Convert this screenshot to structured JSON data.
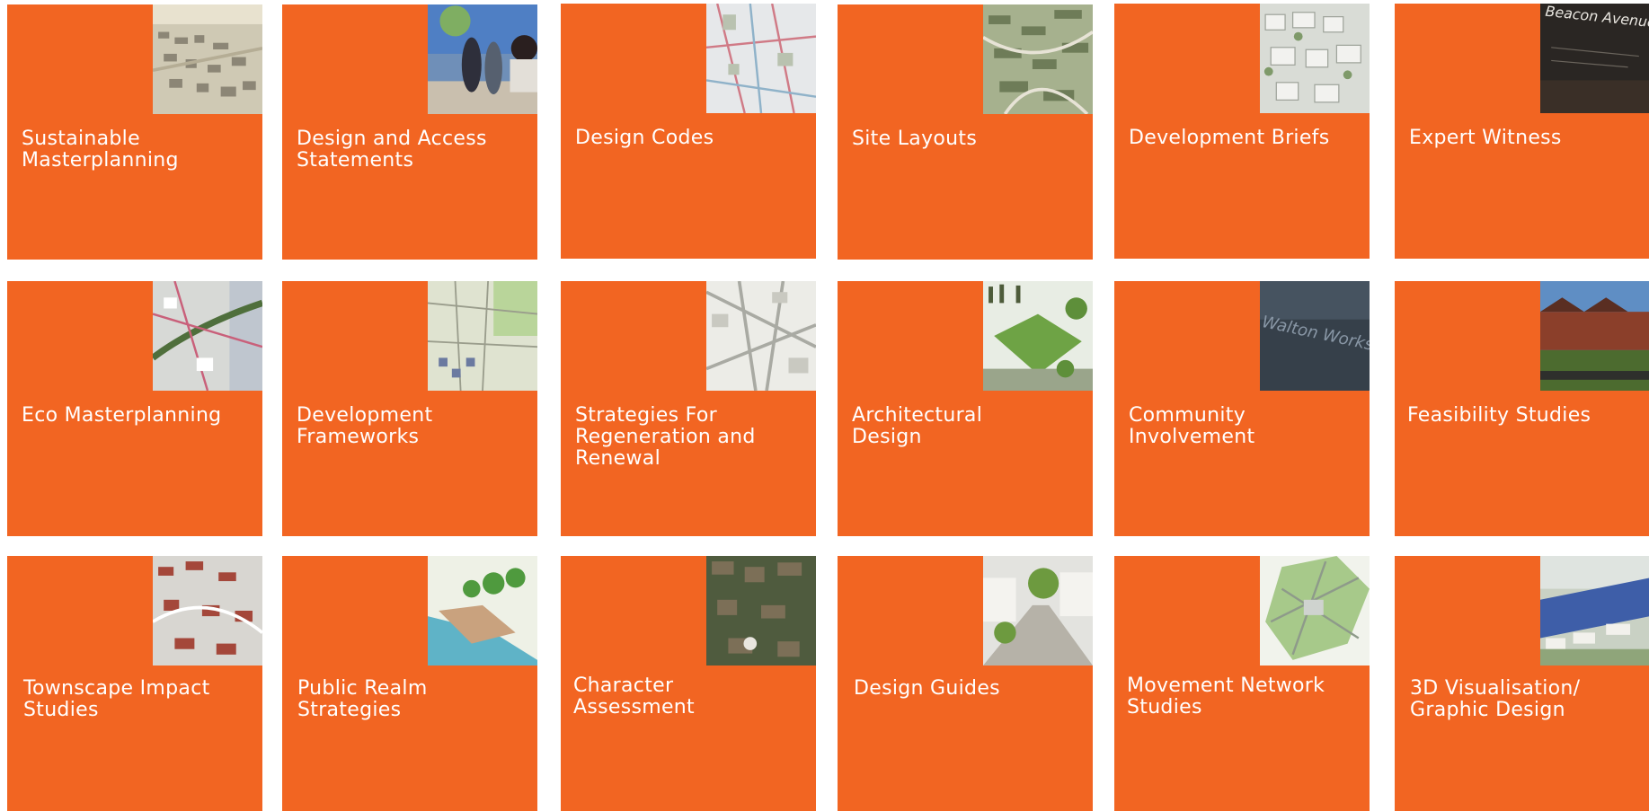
{
  "theme": {
    "tile_color": "#f26522",
    "text_color": "#ffffff"
  },
  "tiles": [
    {
      "label": "Sustainable\nMasterplanning",
      "thumbnail": "aerial-town-image"
    },
    {
      "label": "Design and Access\nStatements",
      "thumbnail": "pedestrians-street-photo"
    },
    {
      "label": "Design Codes",
      "thumbnail": "coded-street-plan-image"
    },
    {
      "label": "Site Layouts",
      "thumbnail": "3d-site-layout-image"
    },
    {
      "label": "Development Briefs",
      "thumbnail": "housing-model-image"
    },
    {
      "label": "Expert Witness",
      "thumbnail": "beacon-avenue-sign-photo",
      "thumbnail_text": "Beacon Avenue"
    },
    {
      "label": "Eco Masterplanning",
      "thumbnail": "eco-plan-map-image"
    },
    {
      "label": "Development\nFrameworks",
      "thumbnail": "framework-plan-image"
    },
    {
      "label": "Strategies For\nRegeneration and\nRenewal",
      "thumbnail": "regeneration-map-image"
    },
    {
      "label": "Architectural\nDesign",
      "thumbnail": "green-roof-building-image"
    },
    {
      "label": "Community\nInvolvement",
      "thumbnail": "walton-works-sign-photo",
      "thumbnail_text": "Walton Works"
    },
    {
      "label": "Feasibility Studies",
      "thumbnail": "brick-houses-photo"
    },
    {
      "label": "Townscape Impact\nStudies",
      "thumbnail": "townscape-aerial-image"
    },
    {
      "label": "Public Realm\nStrategies",
      "thumbnail": "waterfront-plan-image"
    },
    {
      "label": "Character\nAssessment",
      "thumbnail": "satellite-aerial-photo"
    },
    {
      "label": "Design Guides",
      "thumbnail": "street-visualisation-image"
    },
    {
      "label": "Movement Network\nStudies",
      "thumbnail": "movement-network-map-image"
    },
    {
      "label": "3D Visualisation/\nGraphic Design",
      "thumbnail": "3d-development-render-image"
    }
  ]
}
